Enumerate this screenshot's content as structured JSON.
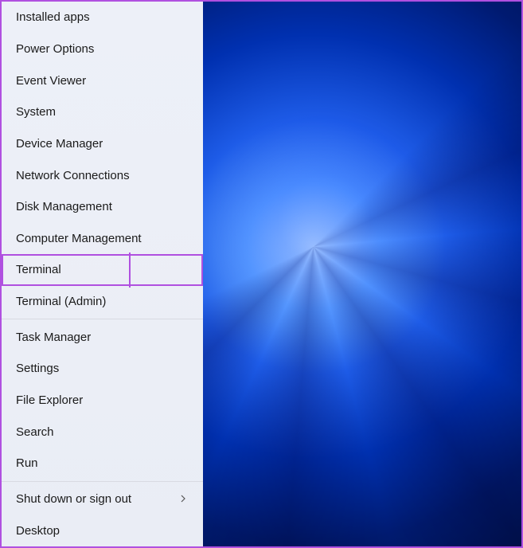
{
  "menu": {
    "groups": [
      {
        "items": [
          {
            "id": "installed-apps",
            "label": "Installed apps"
          },
          {
            "id": "power-options",
            "label": "Power Options"
          },
          {
            "id": "event-viewer",
            "label": "Event Viewer"
          },
          {
            "id": "system",
            "label": "System"
          },
          {
            "id": "device-manager",
            "label": "Device Manager"
          },
          {
            "id": "network-connections",
            "label": "Network Connections"
          },
          {
            "id": "disk-management",
            "label": "Disk Management"
          },
          {
            "id": "computer-management",
            "label": "Computer Management"
          },
          {
            "id": "terminal",
            "label": "Terminal",
            "highlighted": true
          },
          {
            "id": "terminal-admin",
            "label": "Terminal (Admin)"
          }
        ]
      },
      {
        "items": [
          {
            "id": "task-manager",
            "label": "Task Manager"
          },
          {
            "id": "settings",
            "label": "Settings"
          },
          {
            "id": "file-explorer",
            "label": "File Explorer"
          },
          {
            "id": "search",
            "label": "Search"
          },
          {
            "id": "run",
            "label": "Run"
          }
        ]
      },
      {
        "items": [
          {
            "id": "shutdown-signout",
            "label": "Shut down or sign out",
            "submenu": true
          },
          {
            "id": "desktop",
            "label": "Desktop"
          }
        ]
      }
    ]
  },
  "colors": {
    "highlight": "#b050e0",
    "menu_bg": "#edf0f8",
    "text": "#1a1a1a"
  }
}
